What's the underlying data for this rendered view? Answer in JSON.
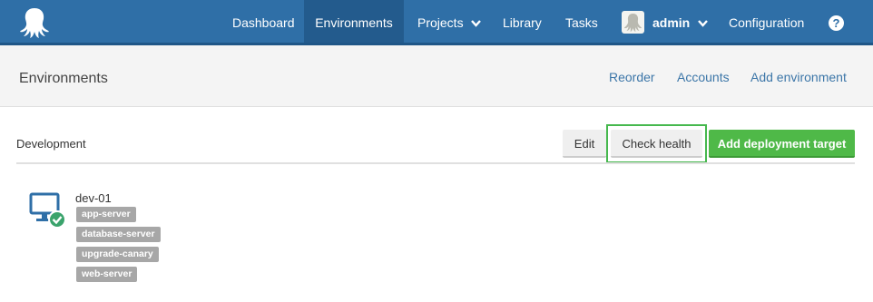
{
  "nav": {
    "items": [
      {
        "label": "Dashboard"
      },
      {
        "label": "Environments"
      },
      {
        "label": "Projects"
      },
      {
        "label": "Library"
      },
      {
        "label": "Tasks"
      }
    ],
    "user": {
      "label": "admin"
    },
    "configuration_label": "Configuration",
    "help_label": "?"
  },
  "header": {
    "title": "Environments",
    "links": {
      "reorder": "Reorder",
      "accounts": "Accounts",
      "add_environment": "Add environment"
    }
  },
  "environment": {
    "name": "Development",
    "buttons": {
      "edit": "Edit",
      "check_health": "Check health",
      "add_target": "Add deployment target"
    },
    "machine": {
      "name": "dev-01",
      "status": "healthy",
      "roles": [
        "app-server",
        "database-server",
        "upgrade-canary",
        "web-server"
      ]
    }
  },
  "colors": {
    "topbar": "#2f6fa7",
    "active_nav": "#235b8d",
    "accent_green": "#4fb948",
    "link": "#3c76a8",
    "tag": "#a7a7a7"
  },
  "icons": {
    "logo": "octopus-logo-icon",
    "projects_menu": "chevron-down-icon",
    "user_menu": "chevron-down-icon",
    "help": "help-icon",
    "machine": "monitor-icon",
    "status": "healthy-check-icon"
  }
}
